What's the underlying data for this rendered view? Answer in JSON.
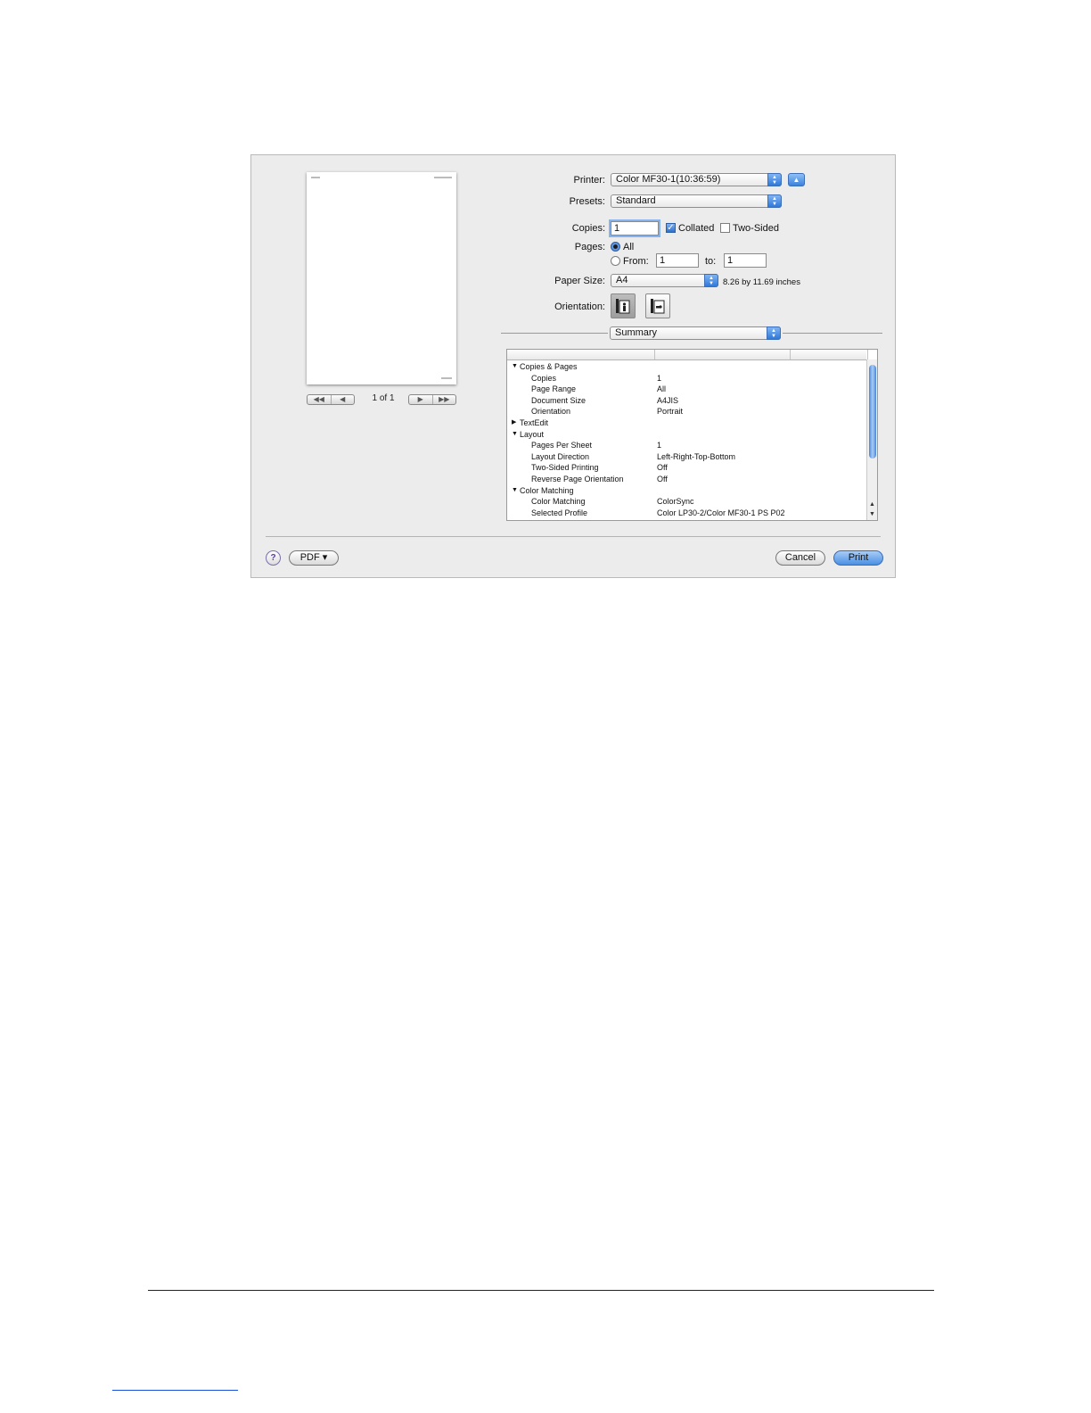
{
  "dialog": {
    "printer": {
      "label": "Printer:",
      "value": "Color MF30-1(10:36:59)"
    },
    "presets": {
      "label": "Presets:",
      "value": "Standard"
    },
    "copies": {
      "label": "Copies:",
      "value": "1",
      "collated": "Collated",
      "collated_checked": true,
      "two_sided": "Two-Sided",
      "two_sided_checked": false
    },
    "pages": {
      "label": "Pages:",
      "all": "All",
      "from": "From:",
      "from_value": "1",
      "to": "to:",
      "to_value": "1",
      "selected": "All"
    },
    "paper_size": {
      "label": "Paper Size:",
      "value": "A4",
      "dimensions": "8.26 by 11.69 inches"
    },
    "orientation": {
      "label": "Orientation:",
      "selected": "portrait"
    },
    "panel": {
      "value": "Summary"
    },
    "summary": [
      {
        "indent": 0,
        "expanded": true,
        "key": "Copies & Pages",
        "value": ""
      },
      {
        "indent": 1,
        "key": "Copies",
        "value": "1"
      },
      {
        "indent": 1,
        "key": "Page Range",
        "value": "All"
      },
      {
        "indent": 1,
        "key": "Document Size",
        "value": "A4JIS"
      },
      {
        "indent": 1,
        "key": "Orientation",
        "value": "Portrait"
      },
      {
        "indent": 0,
        "expanded": false,
        "key": "TextEdit",
        "value": ""
      },
      {
        "indent": 0,
        "expanded": true,
        "key": "Layout",
        "value": ""
      },
      {
        "indent": 1,
        "key": "Pages Per Sheet",
        "value": "1"
      },
      {
        "indent": 1,
        "key": "Layout Direction",
        "value": "Left-Right-Top-Bottom"
      },
      {
        "indent": 1,
        "key": "Two-Sided Printing",
        "value": "Off"
      },
      {
        "indent": 1,
        "key": "Reverse Page Orientation",
        "value": "Off"
      },
      {
        "indent": 0,
        "expanded": true,
        "key": "Color Matching",
        "value": ""
      },
      {
        "indent": 1,
        "key": "Color Matching",
        "value": "ColorSync"
      },
      {
        "indent": 1,
        "key": "Selected Profile",
        "value": "Color LP30-2/Color MF30-1 PS P02"
      }
    ],
    "preview": {
      "page_count": "1 of 1"
    },
    "buttons": {
      "help": "?",
      "pdf": "PDF ▾",
      "cancel": "Cancel",
      "print": "Print"
    },
    "accent_color": "#3a82de"
  }
}
